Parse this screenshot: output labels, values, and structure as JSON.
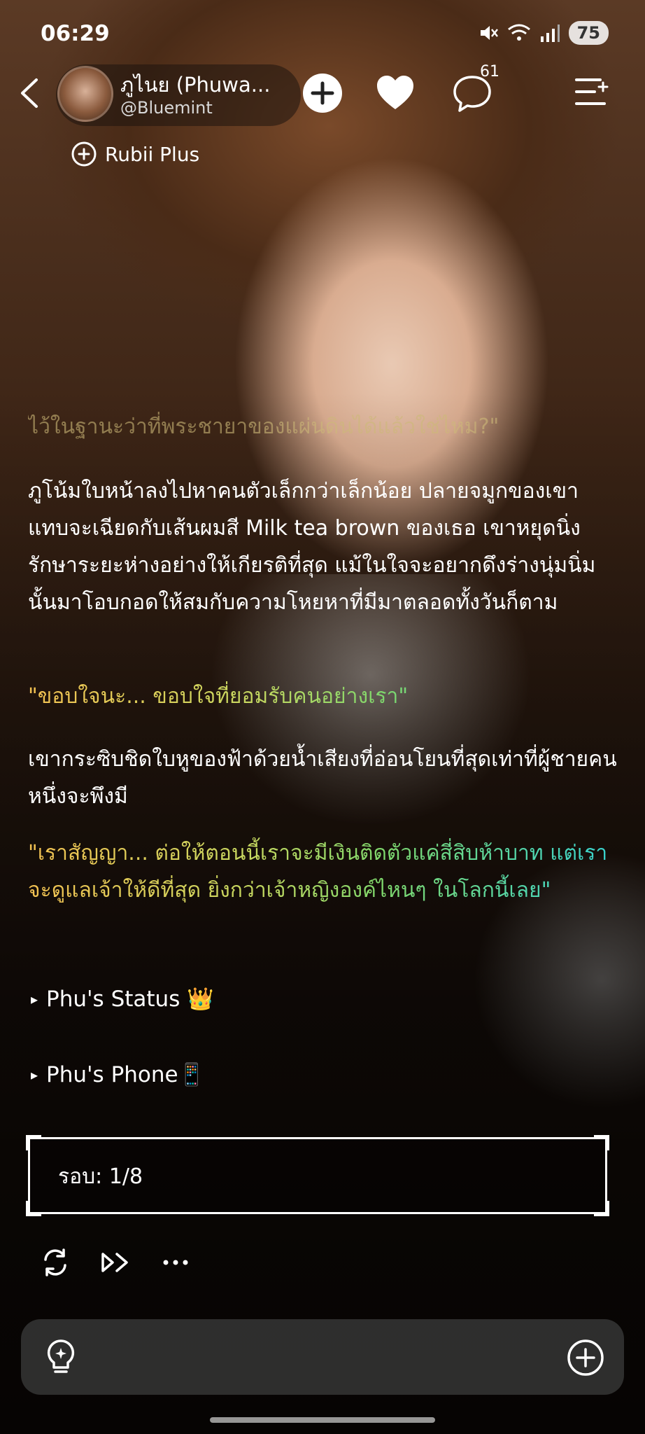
{
  "status_bar": {
    "time": "06:29",
    "battery": "75",
    "icons": [
      "mute-icon",
      "wifi-icon",
      "signal-icon"
    ]
  },
  "header": {
    "character_name": "ภูไนย (Phuwa...",
    "handle": "@Bluemint",
    "comment_count": "61",
    "icons": [
      "back-icon",
      "add-icon",
      "heart-icon",
      "comment-icon",
      "menu-icon"
    ]
  },
  "badge": {
    "label": "Rubii Plus",
    "icon": "rubii-icon"
  },
  "story": {
    "cut_line": "ไว้ในฐานะว่าที่พระชายาของแผ่นดินได้แล้วใช่ไหม?\"",
    "paragraph1": "ภูโน้มใบหน้าลงไปหาคนตัวเล็กกว่าเล็กน้อย ปลายจมูกของเขาแทบจะเฉียดกับเส้นผมสี Milk tea brown ของเธอ เขาหยุดนิ่งรักษาระยะห่างอย่างให้เกียรติที่สุด แม้ในใจจะอยากดึงร่างนุ่มนิ่มนั้นมาโอบกอดให้สมกับความโหยหาที่มีมาตลอดทั้งวันก็ตาม",
    "quote1": "\"ขอบใจนะ... ขอบใจที่ยอมรับคนอย่างเรา\"",
    "paragraph2": "เขากระซิบชิดใบหูของฟ้าด้วยน้ำเสียงที่อ่อนโยนที่สุดเท่าที่ผู้ชายคนหนึ่งจะพึงมี",
    "quote2": "\"เราสัญญา... ต่อให้ตอนนี้เราจะมีเงินติดตัวแค่สี่สิบห้าบาท แต่เราจะดูแลเจ้าให้ดีที่สุด ยิ่งกว่าเจ้าหญิงองค์ไหนๆ ในโลกนี้เลย\""
  },
  "toggles": [
    {
      "arrow": "▸",
      "label": "Phu's Status 👑"
    },
    {
      "arrow": "▸",
      "label": "Phu's Phone📱"
    }
  ],
  "round": {
    "label": "รอบ: 1/8"
  },
  "actions": [
    "regenerate-icon",
    "continue-icon",
    "more-icon"
  ],
  "composer": {
    "icons": [
      "lightbulb-icon",
      "plus-circle-icon"
    ]
  },
  "colors": {
    "quote_gradient": [
      "#f4c252",
      "#7fd86c",
      "#36d3d3"
    ]
  }
}
